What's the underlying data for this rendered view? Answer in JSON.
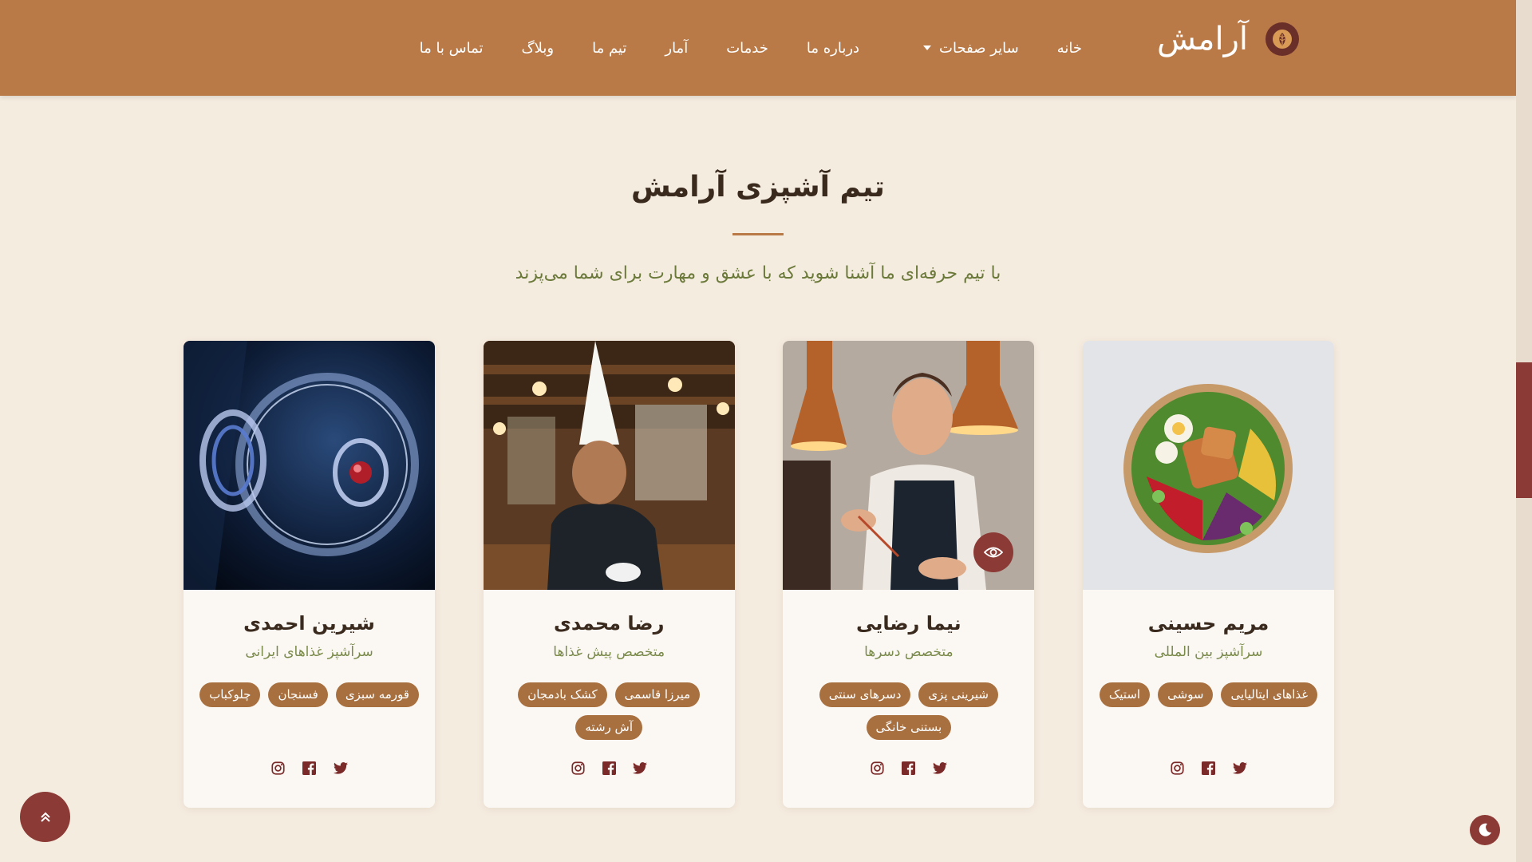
{
  "brand": {
    "name": "آرامش",
    "logo_icon": "leaf-emblem-icon"
  },
  "nav": {
    "items": [
      {
        "label": "خانه"
      },
      {
        "label": "سایر صفحات",
        "dropdown": true
      },
      {
        "label": "درباره ما"
      },
      {
        "label": "خدمات"
      },
      {
        "label": "آمار"
      },
      {
        "label": "تیم ما"
      },
      {
        "label": "وبلاگ"
      },
      {
        "label": "تماس با ما"
      }
    ]
  },
  "section": {
    "title": "تیم آشپزی آرامش",
    "subtitle": "با تیم حرفه‌ای ما آشنا شوید که با عشق و مهارت برای شما می‌پزند"
  },
  "team": [
    {
      "name": "شیرین احمدی",
      "role": "سرآشپز غذاهای ایرانی",
      "tags": [
        "قورمه سبزی",
        "فسنجان",
        "چلوکباب"
      ],
      "image": "abstract-glass-sphere"
    },
    {
      "name": "رضا محمدی",
      "role": "متخصص پیش غذاها",
      "tags": [
        "میرزا قاسمی",
        "کشک بادمجان",
        "آش رشته"
      ],
      "image": "chef-portrait"
    },
    {
      "name": "نیما رضایی",
      "role": "متخصص دسرها",
      "tags": [
        "شیرینی پزی",
        "دسرهای سنتی",
        "بستنی خانگی"
      ],
      "image": "chef-cooking"
    },
    {
      "name": "مریم حسینی",
      "role": "سرآشپز بین المللی",
      "tags": [
        "غذاهای ایتالیایی",
        "سوشی",
        "استیک"
      ],
      "image": "salad-bowl"
    }
  ],
  "socials": [
    "twitter-icon",
    "facebook-icon",
    "instagram-icon"
  ],
  "colors": {
    "header": "#b97a48",
    "background": "#f5ece0",
    "tag": "#a9703f",
    "accent": "#8c3a36",
    "subtitle": "#6b7a3a"
  }
}
